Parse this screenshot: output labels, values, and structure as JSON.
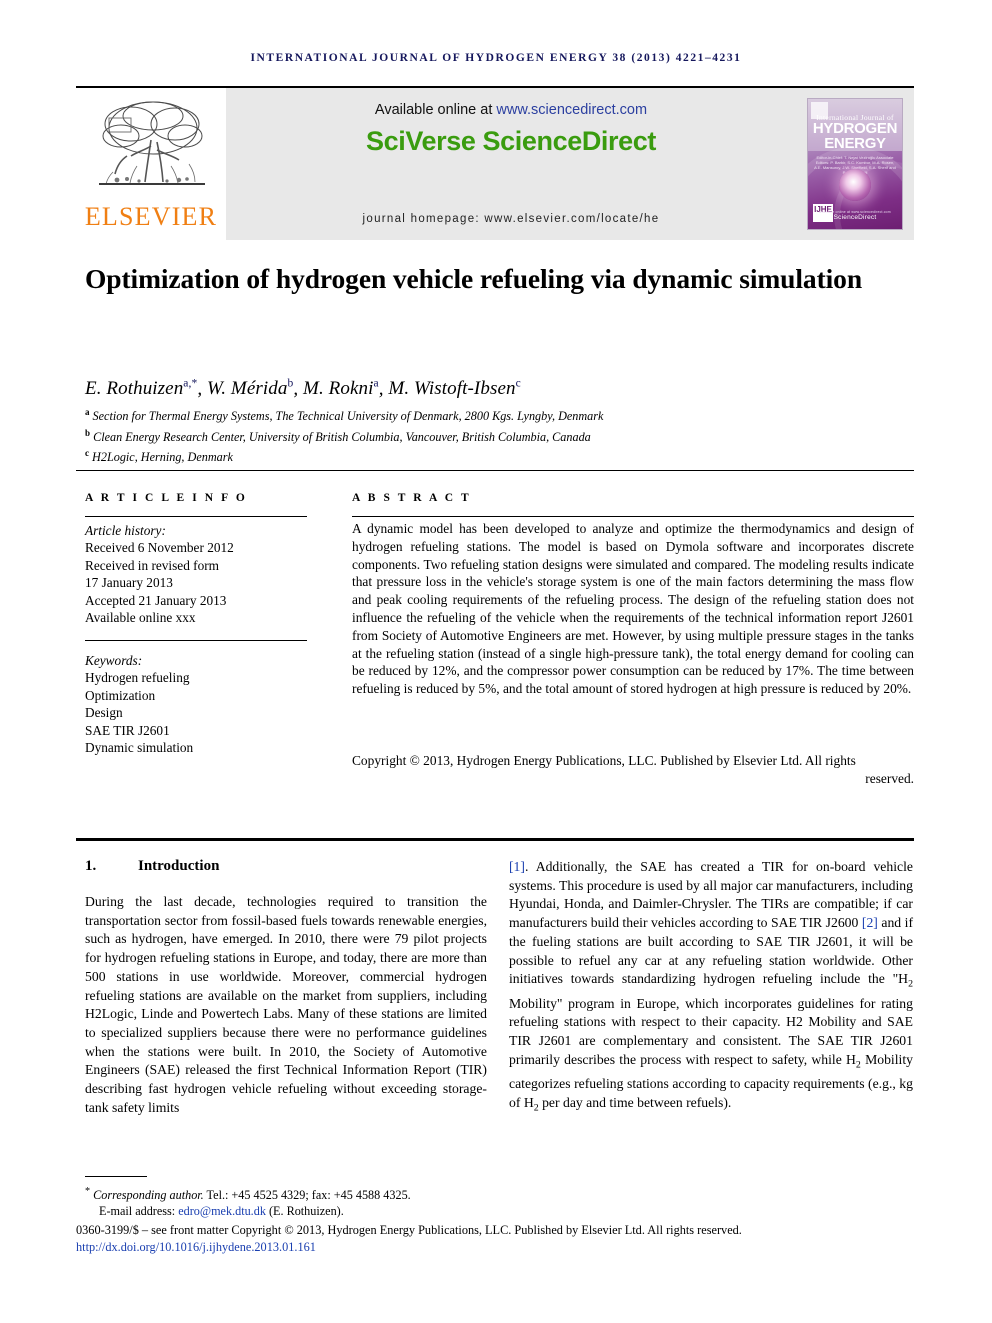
{
  "running_head": "International Journal of Hydrogen Energy 38 (2013) 4221–4231",
  "masthead": {
    "publisher_name": "ELSEVIER",
    "available_prefix": "Available online at ",
    "available_url": "www.sciencedirect.com",
    "platform_logo": "SciVerse ScienceDirect",
    "homepage": "journal homepage: www.elsevier.com/locate/he",
    "cover": {
      "line1": "International Journal of",
      "line2": "HYDROGEN",
      "line3": "ENERGY",
      "editors": "Editor-in-Chief:  T. Nejat Veziroğlu   Associate Editors:  P. Barbir, S.C. Kumbur, M.A. Rosen, A.E. Mansuroy, J.W. Sheffield, S.A. Sherif and R.S. Yedavalli",
      "sciencedirect": "ScienceDirect",
      "sciencedirect_small": "available online at www.sciencedirect.com",
      "badge": "IJHE"
    }
  },
  "article": {
    "title": "Optimization of hydrogen vehicle refueling via dynamic simulation",
    "authors": [
      {
        "name": "E. Rothuizen",
        "marks": "a,*"
      },
      {
        "name": "W. Mérida",
        "marks": "b"
      },
      {
        "name": "M. Rokni",
        "marks": "a"
      },
      {
        "name": "M. Wistoft-Ibsen",
        "marks": "c"
      }
    ],
    "affiliations": [
      {
        "mark": "a",
        "text": "Section for Thermal Energy Systems, The Technical University of Denmark, 2800 Kgs. Lyngby, Denmark"
      },
      {
        "mark": "b",
        "text": "Clean Energy Research Center, University of British Columbia, Vancouver, British Columbia, Canada"
      },
      {
        "mark": "c",
        "text": "H2Logic, Herning, Denmark"
      }
    ]
  },
  "article_info": {
    "heading": "A R T I C L E  I N F O",
    "history_label": "Article history:",
    "history": [
      "Received 6 November 2012",
      "Received in revised form",
      "17 January 2013",
      "Accepted 21 January 2013",
      "Available online xxx"
    ],
    "keywords_label": "Keywords:",
    "keywords": [
      "Hydrogen refueling",
      "Optimization",
      "Design",
      "SAE TIR J2601",
      "Dynamic simulation"
    ]
  },
  "abstract": {
    "heading": "A B S T R A C T",
    "body": "A dynamic model has been developed to analyze and optimize the thermodynamics and design of hydrogen refueling stations. The model is based on Dymola software and incorporates discrete components. Two refueling station designs were simulated and compared. The modeling results indicate that pressure loss in the vehicle's storage system is one of the main factors determining the mass flow and peak cooling requirements of the refueling process. The design of the refueling station does not influence the refueling of the vehicle when the requirements of the technical information report J2601 from Society of Automotive Engineers are met. However, by using multiple pressure stages in the tanks at the refueling station (instead of a single high-pressure tank), the total energy demand for cooling can be reduced by 12%, and the compressor power consumption can be reduced by 17%. The time between refueling is reduced by 5%, and the total amount of stored hydrogen at high pressure is reduced by 20%.",
    "copyright_main": "Copyright © 2013, Hydrogen Energy Publications, LLC. Published by Elsevier Ltd. All rights",
    "copyright_tail": "reserved."
  },
  "section": {
    "number": "1.",
    "title": "Introduction",
    "left_column": "During the last decade, technologies required to transition the transportation sector from fossil-based fuels towards renewable energies, such as hydrogen, have emerged. In 2010, there were 79 pilot projects for hydrogen refueling stations in Europe, and today, there are more than 500 stations in use worldwide. Moreover, commercial hydrogen refueling stations are available on the market from suppliers, including H2Logic, Linde and Powertech Labs. Many of these stations are limited to specialized suppliers because there were no performance guidelines when the stations were built. In 2010, the Society of Automotive Engineers (SAE) released the first Technical Information Report (TIR) describing fast hydrogen vehicle refueling without exceeding storage-tank safety limits",
    "right_column_part1": ". Additionally, the SAE has created a TIR for on-board vehicle systems. This procedure is used by all major car manufacturers, including Hyundai, Honda, and Daimler-Chrysler. The TIRs are compatible; if car manufacturers build their vehicles according to SAE TIR J2600 ",
    "right_column_part2": " and if the fueling stations are built according to SAE TIR J2601, it will be possible to refuel any car at any refueling station worldwide. Other initiatives towards standardizing hydrogen refueling include the \"H",
    "right_column_part3": " Mobility\" program in Europe, which incorporates guidelines for rating refueling stations with respect to their capacity. H2 Mobility and SAE TIR J2601 are complementary and consistent. The SAE TIR J2601 primarily describes the process with respect to safety, while H",
    "right_column_part4": " Mobility categorizes refueling stations according to capacity requirements (e.g., kg of H",
    "right_column_part5": " per day and time between refuels).",
    "ref1": "[1]",
    "ref2": "[2]",
    "subscript": "2"
  },
  "footer": {
    "corresponding_star": "*",
    "corresponding_label": "Corresponding author.",
    "corresponding_rest": " Tel.: +45 4525 4329; fax: +45 4588 4325.",
    "email_label": "E-mail address: ",
    "email": "edro@mek.dtu.dk",
    "email_owner": " (E. Rothuizen).",
    "issn_line": "0360-3199/$ – see front matter Copyright © 2013, Hydrogen Energy Publications, LLC. Published by Elsevier Ltd. All rights reserved.",
    "doi": "http://dx.doi.org/10.1016/j.ijhydene.2013.01.161"
  }
}
